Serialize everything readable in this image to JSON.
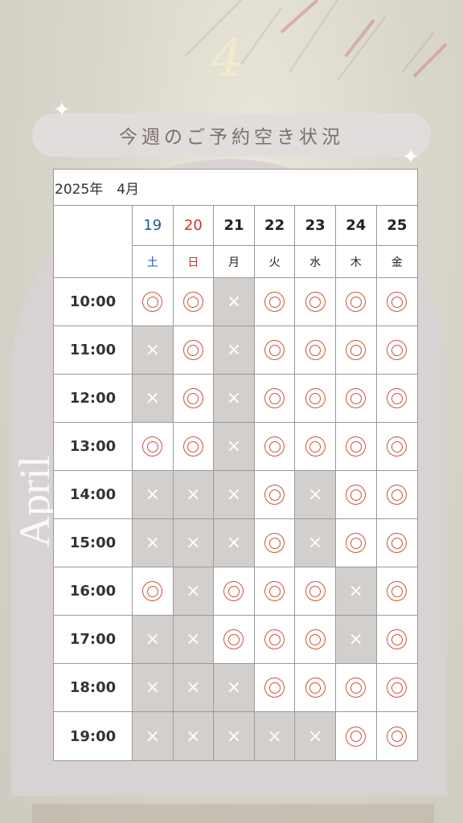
{
  "header": {
    "big_number": "4",
    "title": "今週のご予約空き状況",
    "vertical_label": "April"
  },
  "calendar": {
    "month_label": "2025年　4月",
    "days": [
      {
        "date": "19",
        "dow": "土",
        "color": "#1f56a8"
      },
      {
        "date": "20",
        "dow": "日",
        "color": "#c0392b"
      },
      {
        "date": "21",
        "dow": "月",
        "color": "#222222"
      },
      {
        "date": "22",
        "dow": "火",
        "color": "#222222"
      },
      {
        "date": "23",
        "dow": "水",
        "color": "#222222"
      },
      {
        "date": "24",
        "dow": "木",
        "color": "#222222"
      },
      {
        "date": "25",
        "dow": "金",
        "color": "#222222"
      }
    ],
    "rows": [
      {
        "time": "10:00",
        "slots": [
          "◎",
          "◎",
          "×",
          "◎",
          "◎",
          "◎",
          "◎"
        ]
      },
      {
        "time": "11:00",
        "slots": [
          "×",
          "◎",
          "×",
          "◎",
          "◎",
          "◎",
          "◎"
        ]
      },
      {
        "time": "12:00",
        "slots": [
          "×",
          "◎",
          "×",
          "◎",
          "◎",
          "◎",
          "◎"
        ]
      },
      {
        "time": "13:00",
        "slots": [
          "◎",
          "◎",
          "×",
          "◎",
          "◎",
          "◎",
          "◎"
        ]
      },
      {
        "time": "14:00",
        "slots": [
          "×",
          "×",
          "×",
          "◎",
          "×",
          "◎",
          "◎"
        ]
      },
      {
        "time": "15:00",
        "slots": [
          "×",
          "×",
          "×",
          "◎",
          "×",
          "◎",
          "◎"
        ]
      },
      {
        "time": "16:00",
        "slots": [
          "◎",
          "×",
          "◎",
          "◎",
          "◎",
          "×",
          "◎"
        ]
      },
      {
        "time": "17:00",
        "slots": [
          "×",
          "×",
          "◎",
          "◎",
          "◎",
          "×",
          "◎"
        ]
      },
      {
        "time": "18:00",
        "slots": [
          "×",
          "×",
          "×",
          "◎",
          "◎",
          "◎",
          "◎"
        ]
      },
      {
        "time": "19:00",
        "slots": [
          "×",
          "×",
          "×",
          "×",
          "×",
          "◎",
          "◎"
        ]
      }
    ]
  },
  "colors": {
    "available_mark": "#c8553f",
    "closed_bg": "#d3cfcd",
    "arch_bg": "#d8d3d2"
  }
}
